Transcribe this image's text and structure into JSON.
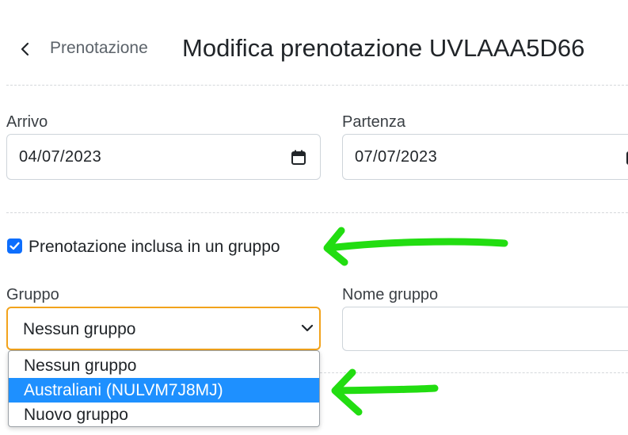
{
  "header": {
    "back_label": "Prenotazione",
    "title": "Modifica prenotazione UVLAAA5D66"
  },
  "dates": {
    "arrival_label": "Arrivo",
    "arrival_value": "04/07/2023",
    "departure_label": "Partenza",
    "departure_value": "07/07/2023"
  },
  "group": {
    "checkbox_label": "Prenotazione inclusa in un gruppo",
    "checkbox_checked": true,
    "select_label": "Gruppo",
    "select_value": "Nessun gruppo",
    "name_label": "Nome gruppo",
    "name_value": "",
    "options": [
      "Nessun gruppo",
      "Australiani (NULVM7J8MJ)",
      "Nuovo gruppo"
    ],
    "highlighted_option": "Australiani (NULVM7J8MJ)"
  },
  "icons": {
    "back": "chevron-left-icon",
    "calendar": "calendar-icon",
    "select_chevron": "chevron-down-icon",
    "annotation": "green-arrow-icon"
  },
  "colors": {
    "accent": "#0d6efd",
    "focus_border": "#f2a31c",
    "highlight": "#1e90ff",
    "annotation_arrow": "#22dd11"
  }
}
